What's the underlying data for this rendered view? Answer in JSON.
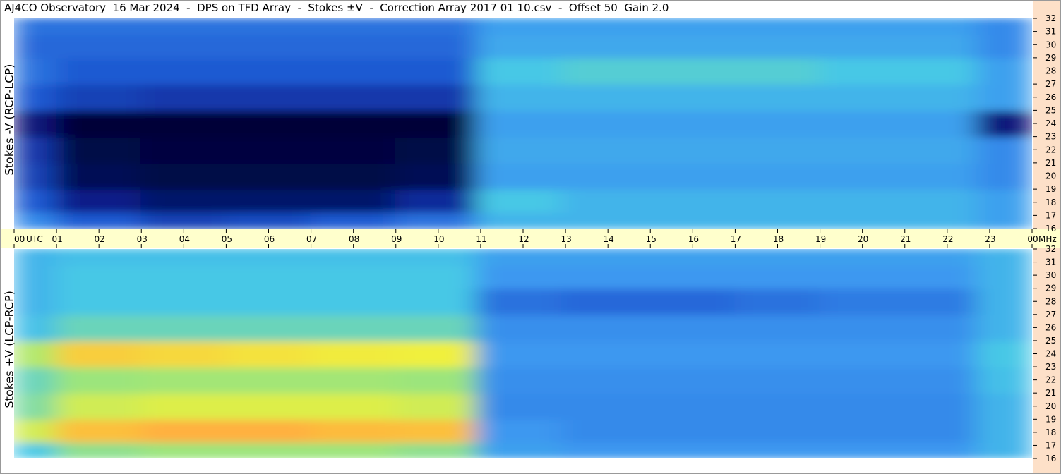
{
  "title": "AJ4CO Observatory  16 Mar 2024  -  DPS on TFD Array  -  Stokes ±V  -  Correction Array 2017 01 10.csv  -  Offset 50  Gain 2.0",
  "colors": {
    "freq_axis_bg": "#fde0c8",
    "time_axis_bg": "#ffffcc",
    "colormap": [
      "#000030",
      "#0a1e8c",
      "#1e5ad2",
      "#3c96f0",
      "#46c8e6",
      "#a0e678",
      "#f0f03c",
      "#ffb43c",
      "#ff6496"
    ]
  },
  "chart_data": {
    "type": "heatmap",
    "title": "AJ4CO Observatory  16 Mar 2024  -  DPS on TFD Array  -  Stokes ±V  -  Correction Array 2017 01 10.csv  -  Offset 50  Gain 2.0",
    "x_axis": {
      "unit_label": "UTC",
      "ticks": [
        "00",
        "01",
        "02",
        "03",
        "04",
        "05",
        "06",
        "07",
        "08",
        "09",
        "10",
        "11",
        "12",
        "13",
        "14",
        "15",
        "16",
        "17",
        "18",
        "19",
        "20",
        "21",
        "22",
        "23",
        "00"
      ],
      "range_hours": [
        0,
        24
      ]
    },
    "y_axis": {
      "unit_label": "MHz",
      "ticks": [
        16,
        17,
        18,
        19,
        20,
        21,
        22,
        23,
        24,
        25,
        26,
        27,
        28,
        29,
        30,
        31,
        32
      ],
      "range_mhz": [
        16,
        32
      ]
    },
    "panels": [
      {
        "name": "Stokes -V (RCP-LCP)",
        "ylabel": "Stokes -V (RCP-LCP)",
        "x_hours": [
          0,
          2,
          4,
          6,
          8,
          10,
          11.8,
          14,
          16,
          18,
          20,
          22,
          23.4
        ],
        "y_mhz": [
          16.5,
          18,
          20,
          22,
          24,
          26,
          28,
          30,
          31.5
        ],
        "intensity": [
          [
            0.35,
            0.25,
            0.2,
            0.22,
            0.25,
            0.3,
            0.45,
            0.45,
            0.45,
            0.45,
            0.45,
            0.45,
            0.4
          ],
          [
            0.25,
            0.12,
            0.08,
            0.08,
            0.08,
            0.15,
            0.5,
            0.45,
            0.45,
            0.45,
            0.45,
            0.45,
            0.4
          ],
          [
            0.2,
            0.05,
            0.03,
            0.03,
            0.03,
            0.05,
            0.4,
            0.4,
            0.4,
            0.4,
            0.4,
            0.4,
            0.35
          ],
          [
            0.18,
            0.03,
            0.02,
            0.02,
            0.02,
            0.03,
            0.42,
            0.42,
            0.42,
            0.42,
            0.42,
            0.42,
            0.35
          ],
          [
            0.1,
            0.01,
            0.01,
            0.01,
            0.01,
            0.01,
            0.4,
            0.4,
            0.4,
            0.4,
            0.4,
            0.4,
            0.1
          ],
          [
            0.25,
            0.2,
            0.18,
            0.18,
            0.18,
            0.18,
            0.45,
            0.45,
            0.45,
            0.45,
            0.45,
            0.45,
            0.4
          ],
          [
            0.3,
            0.25,
            0.25,
            0.25,
            0.25,
            0.25,
            0.5,
            0.52,
            0.52,
            0.52,
            0.5,
            0.5,
            0.4
          ],
          [
            0.28,
            0.28,
            0.28,
            0.28,
            0.28,
            0.28,
            0.42,
            0.42,
            0.42,
            0.42,
            0.42,
            0.42,
            0.35
          ],
          [
            0.3,
            0.3,
            0.3,
            0.3,
            0.3,
            0.3,
            0.4,
            0.4,
            0.4,
            0.4,
            0.4,
            0.4,
            0.35
          ]
        ]
      },
      {
        "name": "Stokes +V (LCP-RCP)",
        "ylabel": "Stokes +V (LCP-RCP)",
        "x_hours": [
          0,
          2,
          4,
          6,
          8,
          10,
          11.8,
          14,
          16,
          18,
          20,
          22,
          23.4
        ],
        "y_mhz": [
          16.5,
          18,
          20,
          22,
          24,
          26,
          28,
          30,
          31.5
        ],
        "intensity": [
          [
            0.5,
            0.6,
            0.62,
            0.62,
            0.62,
            0.6,
            0.4,
            0.38,
            0.38,
            0.38,
            0.38,
            0.38,
            0.45
          ],
          [
            0.7,
            0.85,
            0.88,
            0.88,
            0.86,
            0.85,
            0.38,
            0.35,
            0.35,
            0.35,
            0.35,
            0.35,
            0.45
          ],
          [
            0.58,
            0.7,
            0.72,
            0.72,
            0.72,
            0.7,
            0.35,
            0.35,
            0.35,
            0.35,
            0.35,
            0.35,
            0.45
          ],
          [
            0.55,
            0.62,
            0.63,
            0.63,
            0.63,
            0.62,
            0.36,
            0.36,
            0.36,
            0.36,
            0.36,
            0.36,
            0.48
          ],
          [
            0.65,
            0.82,
            0.8,
            0.78,
            0.76,
            0.75,
            0.38,
            0.38,
            0.38,
            0.38,
            0.38,
            0.38,
            0.5
          ],
          [
            0.48,
            0.55,
            0.55,
            0.55,
            0.55,
            0.55,
            0.36,
            0.36,
            0.36,
            0.36,
            0.36,
            0.36,
            0.45
          ],
          [
            0.45,
            0.5,
            0.5,
            0.5,
            0.5,
            0.5,
            0.3,
            0.28,
            0.28,
            0.3,
            0.32,
            0.32,
            0.45
          ],
          [
            0.45,
            0.5,
            0.5,
            0.5,
            0.5,
            0.5,
            0.38,
            0.38,
            0.38,
            0.38,
            0.38,
            0.38,
            0.45
          ],
          [
            0.45,
            0.48,
            0.48,
            0.48,
            0.48,
            0.48,
            0.4,
            0.4,
            0.4,
            0.4,
            0.4,
            0.4,
            0.45
          ]
        ]
      }
    ],
    "grid": false,
    "legend": "none"
  }
}
